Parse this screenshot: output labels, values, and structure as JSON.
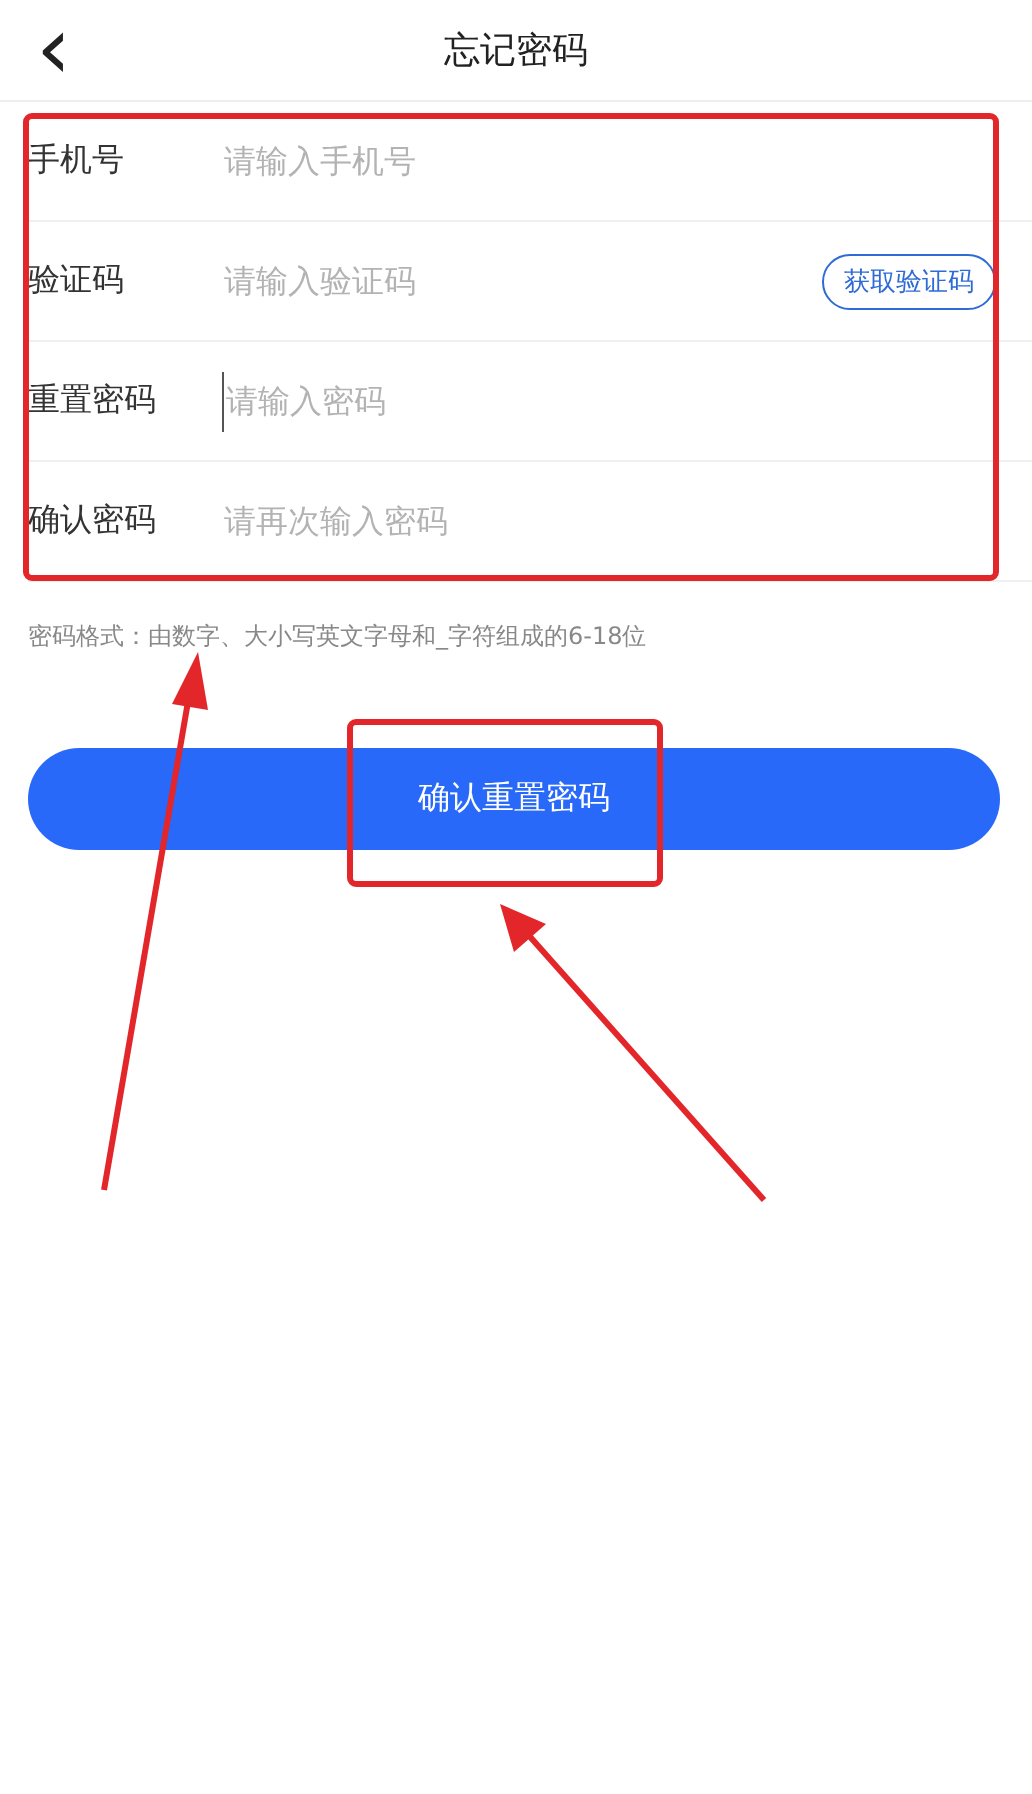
{
  "header": {
    "back": "‹",
    "title": "忘记密码"
  },
  "rows": [
    {
      "kind": "plain",
      "label": "手机号",
      "placeholder": "请输入手机号",
      "focused": false
    },
    {
      "kind": "code",
      "label": "验证码",
      "placeholder": "请输入验证码",
      "focused": false,
      "button": "获取验证码"
    },
    {
      "kind": "plain",
      "label": "重置密码",
      "placeholder": "请输入密码",
      "focused": true
    },
    {
      "kind": "plain",
      "label": "确认密码",
      "placeholder": "请再次输入密码",
      "focused": false
    }
  ],
  "hint": "密码格式：由数字、大小写英文字母和_字符组成的6-18位",
  "submit": "确认重置密码"
}
